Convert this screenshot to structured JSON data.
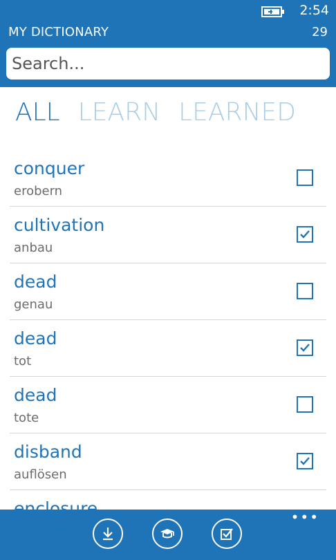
{
  "status_bar": {
    "time": "2:54",
    "battery_icon": "battery-charging-icon"
  },
  "header": {
    "title": "MY DICTIONARY",
    "count": "29"
  },
  "search": {
    "placeholder": "Search..."
  },
  "tabs": [
    {
      "label": "ALL",
      "active": true
    },
    {
      "label": "LEARN",
      "active": false
    },
    {
      "label": "LEARNED",
      "active": false
    }
  ],
  "words": [
    {
      "term": "conquer",
      "translation": "erobern",
      "learned": false
    },
    {
      "term": "cultivation",
      "translation": "anbau",
      "learned": true
    },
    {
      "term": "dead",
      "translation": "genau",
      "learned": false
    },
    {
      "term": "dead",
      "translation": "tot",
      "learned": true
    },
    {
      "term": "dead",
      "translation": "tote",
      "learned": false
    },
    {
      "term": "disband",
      "translation": "auflösen",
      "learned": true
    },
    {
      "term": "enclosure",
      "translation": "",
      "learned": false
    }
  ],
  "app_bar": {
    "buttons": [
      {
        "icon": "download-icon"
      },
      {
        "icon": "graduation-cap-icon"
      },
      {
        "icon": "check-square-icon"
      }
    ],
    "more_label": "•••"
  },
  "colors": {
    "accent": "#1f74b8",
    "tab_inactive": "#a9cde6"
  }
}
